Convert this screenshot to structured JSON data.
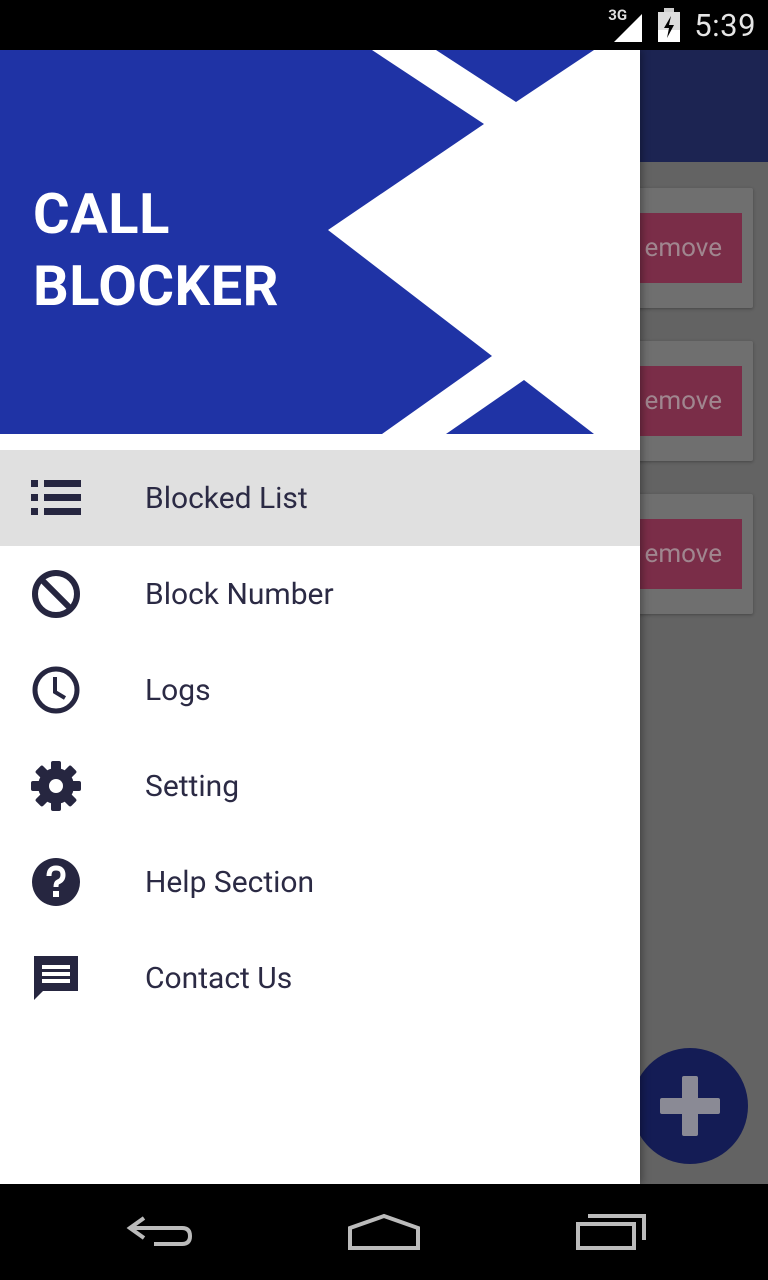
{
  "status_bar": {
    "time": "5:39",
    "network": "3G",
    "icons": [
      "signal-icon",
      "battery-charging-icon"
    ]
  },
  "background_app": {
    "remove_label": "emove",
    "card_count": 3,
    "fab_icon": "add-icon",
    "colors": {
      "toolbar": "#1c2452",
      "remove": "#7a2d48",
      "fab": "#141c55"
    }
  },
  "drawer": {
    "title_line1": "CALL",
    "title_line2": "BLOCKER",
    "header_color": "#1f33a5",
    "items": [
      {
        "label": "Blocked List",
        "icon": "list-icon",
        "active": true
      },
      {
        "label": "Block Number",
        "icon": "block-icon",
        "active": false
      },
      {
        "label": "Logs",
        "icon": "clock-icon",
        "active": false
      },
      {
        "label": "Setting",
        "icon": "gear-icon",
        "active": false
      },
      {
        "label": "Help Section",
        "icon": "help-icon",
        "active": false
      },
      {
        "label": "Contact Us",
        "icon": "chat-icon",
        "active": false
      }
    ]
  },
  "nav_bar": {
    "buttons": [
      "back-icon",
      "home-icon",
      "recents-icon"
    ]
  }
}
